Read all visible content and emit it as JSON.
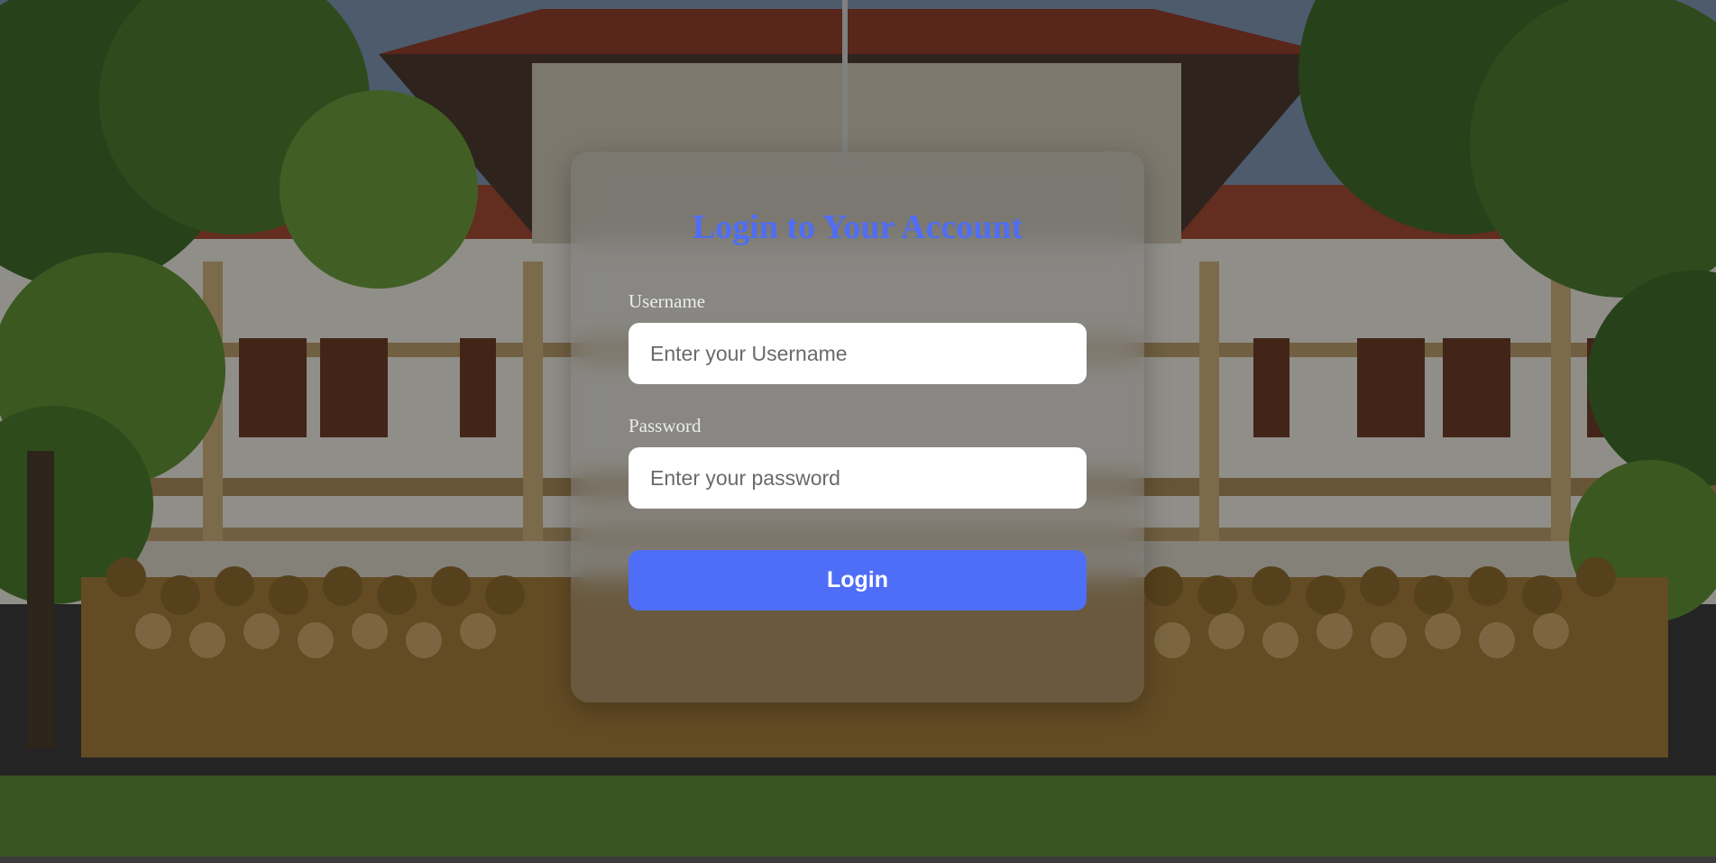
{
  "login_form": {
    "title": "Login to Your Account",
    "username_label": "Username",
    "username_placeholder": "Enter your Username",
    "password_label": "Password",
    "password_placeholder": "Enter your password",
    "login_button_label": "Login"
  },
  "colors": {
    "accent": "#4f6ef7",
    "title": "#4f6df5",
    "input_background": "#ffffff",
    "label_text": "#ececec"
  }
}
